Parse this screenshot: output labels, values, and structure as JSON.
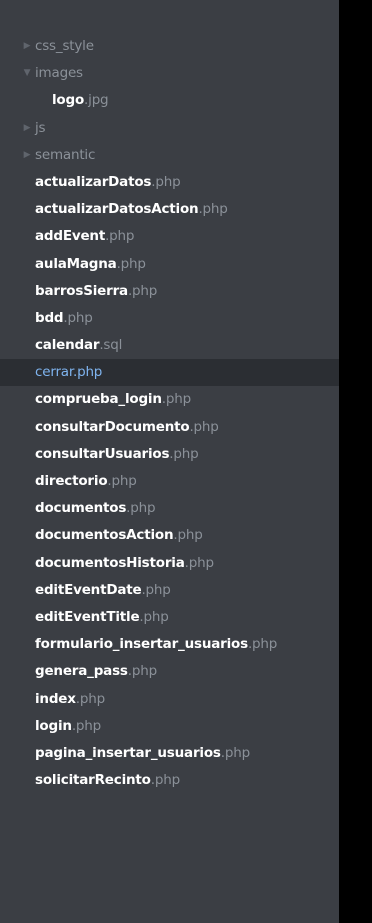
{
  "tree": {
    "folders": {
      "css_style": {
        "label": "css_style",
        "expanded": false
      },
      "images": {
        "label": "images",
        "expanded": true
      },
      "js": {
        "label": "js",
        "expanded": false
      },
      "semantic": {
        "label": "semantic",
        "expanded": false
      }
    },
    "nested_files": [
      {
        "name": "logo",
        "ext": ".jpg"
      }
    ],
    "files": [
      {
        "name": "actualizarDatos",
        "ext": ".php"
      },
      {
        "name": "actualizarDatosAction",
        "ext": ".php"
      },
      {
        "name": "addEvent",
        "ext": ".php"
      },
      {
        "name": "aulaMagna",
        "ext": ".php"
      },
      {
        "name": "barrosSierra",
        "ext": ".php"
      },
      {
        "name": "bdd",
        "ext": ".php"
      },
      {
        "name": "calendar",
        "ext": ".sql"
      },
      {
        "name": "cerrar",
        "ext": ".php"
      },
      {
        "name": "comprueba_login",
        "ext": ".php"
      },
      {
        "name": "consultarDocumento",
        "ext": ".php"
      },
      {
        "name": "consultarUsuarios",
        "ext": ".php"
      },
      {
        "name": "directorio",
        "ext": ".php"
      },
      {
        "name": "documentos",
        "ext": ".php"
      },
      {
        "name": "documentosAction",
        "ext": ".php"
      },
      {
        "name": "documentosHistoria",
        "ext": ".php"
      },
      {
        "name": "editEventDate",
        "ext": ".php"
      },
      {
        "name": "editEventTitle",
        "ext": ".php"
      },
      {
        "name": "formulario_insertar_usuarios",
        "ext": ".php"
      },
      {
        "name": "genera_pass",
        "ext": ".php"
      },
      {
        "name": "index",
        "ext": ".php"
      },
      {
        "name": "login",
        "ext": ".php"
      },
      {
        "name": "pagina_insertar_usuarios",
        "ext": ".php"
      },
      {
        "name": "solicitarRecinto",
        "ext": ".php"
      }
    ],
    "selected_file": "cerrar.php",
    "icons": {
      "collapsed": "triangle-right",
      "expanded": "triangle-down"
    },
    "colors": {
      "panel_background": "#3b3e44",
      "selected_row": "#2b2e33",
      "selected_text": "#7fb4ef",
      "file_name": "#ffffff",
      "dim_text": "#8b9199"
    }
  }
}
